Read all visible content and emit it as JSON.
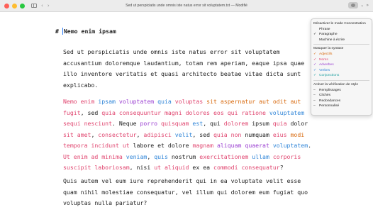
{
  "window": {
    "title": "Sed ut perspiciatis unde omnis iste natus error sit voluptatem.txt — Modifié",
    "back_glyph": "‹",
    "forward_glyph": "›",
    "focus_dropdown_glyph": "⌄",
    "expand_glyph": "»"
  },
  "document": {
    "heading_hash": "# ",
    "heading_first": "N",
    "heading_rest": "emo enim ipsam",
    "paragraph1": [
      "Sed ut perspiciatis unde omnis iste natus error sit voluptatem",
      "accusantium doloremque laudantium, totam rem aperiam, eaque ipsa quae",
      "illo inventore veritatis et quasi architecto beatae vitae dicta sunt",
      "explicabo."
    ],
    "paragraph2": [
      [
        [
          "Nemo ",
          "pink"
        ],
        [
          "enim ",
          "pink"
        ],
        [
          "ipsam ",
          "blue"
        ],
        [
          "voluptatem ",
          "purple"
        ],
        [
          "quia ",
          "blue"
        ],
        [
          "voluptas ",
          "pink"
        ],
        [
          "sit ",
          "orange"
        ],
        [
          "aspernatur ",
          "orange"
        ],
        [
          "aut ",
          "orange"
        ],
        [
          "odit ",
          "orange"
        ],
        [
          "aut",
          "orange"
        ]
      ],
      [
        [
          "fugit",
          "pink"
        ],
        [
          ", sed ",
          "plain"
        ],
        [
          "quia ",
          "pink"
        ],
        [
          "consequuntur ",
          "pink"
        ],
        [
          "magni ",
          "pink"
        ],
        [
          "dolores ",
          "pink"
        ],
        [
          "eos ",
          "pink"
        ],
        [
          "qui ",
          "pink"
        ],
        [
          "ratione ",
          "pink"
        ],
        [
          "voluptatem",
          "blue"
        ]
      ],
      [
        [
          "sequi ",
          "pink"
        ],
        [
          "nesciunt",
          "pink"
        ],
        [
          ". Neque ",
          "plain"
        ],
        [
          "porro ",
          "purple"
        ],
        [
          "quisquam ",
          "pink"
        ],
        [
          "est",
          "blue"
        ],
        [
          ", qui ",
          "plain"
        ],
        [
          "dolorem ",
          "pink"
        ],
        [
          "ipsum ",
          "plain"
        ],
        [
          "quia ",
          "pink"
        ],
        [
          "dolor",
          "plain"
        ]
      ],
      [
        [
          "sit ",
          "pink"
        ],
        [
          "amet",
          "pink"
        ],
        [
          ", ",
          "plain"
        ],
        [
          "consectetur",
          "pink"
        ],
        [
          ", ",
          "plain"
        ],
        [
          "adipisci ",
          "pink"
        ],
        [
          "velit",
          "blue"
        ],
        [
          ", sed ",
          "plain"
        ],
        [
          "quia ",
          "pink"
        ],
        [
          "non ",
          "pink"
        ],
        [
          "numquam ",
          "plain"
        ],
        [
          "eius ",
          "pink"
        ],
        [
          "modi",
          "orange"
        ]
      ],
      [
        [
          "tempora ",
          "pink"
        ],
        [
          "incidunt ",
          "pink"
        ],
        [
          "ut ",
          "pink"
        ],
        [
          "labore ",
          "plain"
        ],
        [
          "et ",
          "plain"
        ],
        [
          "dolore ",
          "plain"
        ],
        [
          "magnam ",
          "pink"
        ],
        [
          "aliquam ",
          "purple"
        ],
        [
          "quaerat ",
          "purple"
        ],
        [
          "voluptatem",
          "blue"
        ],
        [
          ".",
          "plain"
        ]
      ],
      [
        [
          "Ut ",
          "pink"
        ],
        [
          "enim ",
          "pink"
        ],
        [
          "ad ",
          "pink"
        ],
        [
          "minima ",
          "pink"
        ],
        [
          "veniam",
          "blue"
        ],
        [
          ", ",
          "plain"
        ],
        [
          "quis ",
          "blue"
        ],
        [
          "nostrum ",
          "plain"
        ],
        [
          "exercitationem ",
          "pink"
        ],
        [
          "ullam ",
          "blue"
        ],
        [
          "corporis",
          "pink"
        ]
      ],
      [
        [
          "suscipit ",
          "pink"
        ],
        [
          "laboriosam",
          "pink"
        ],
        [
          ", nisi ",
          "plain"
        ],
        [
          "ut ",
          "pink"
        ],
        [
          "aliquid ",
          "pink"
        ],
        [
          "ex ",
          "plain"
        ],
        [
          "ea ",
          "plain"
        ],
        [
          "commodi ",
          "pink"
        ],
        [
          "consequatur",
          "pink"
        ],
        [
          "?",
          "plain"
        ]
      ]
    ],
    "paragraph3": [
      "Quis autem vel eum iure reprehenderit qui in ea voluptate velit esse",
      "quam nihil molestiae consequatur, vel illum qui dolorem eum fugiat quo",
      "voluptas nulla pariatur?"
    ]
  },
  "menu": {
    "disable_focus": "Désactiver le mode Concentration",
    "phrase": "Phrase",
    "paragraph": "Paragraphe",
    "typewriter": "Machine à écrire",
    "mask_syntax": "Masquer la syntaxe",
    "adjectives": "Adjectifs",
    "nouns": "Noms",
    "adverbs": "Adverbes",
    "verbs": "Verbes",
    "conjunctions": "Conjonctions",
    "enable_style_check": "Activer la vérification de style",
    "fillers": "Remplissages",
    "cliches": "Clichés",
    "redundancies": "Redondances",
    "custom": "Personnalisé",
    "check_mark": "✓",
    "dash_mark": "–"
  },
  "colors": {
    "pink": "#e0456f",
    "orange": "#d8690d",
    "blue": "#2f85d8",
    "purple": "#9a3fd1",
    "teal": "#1fa0a0",
    "caret": "#2b7bf5"
  }
}
